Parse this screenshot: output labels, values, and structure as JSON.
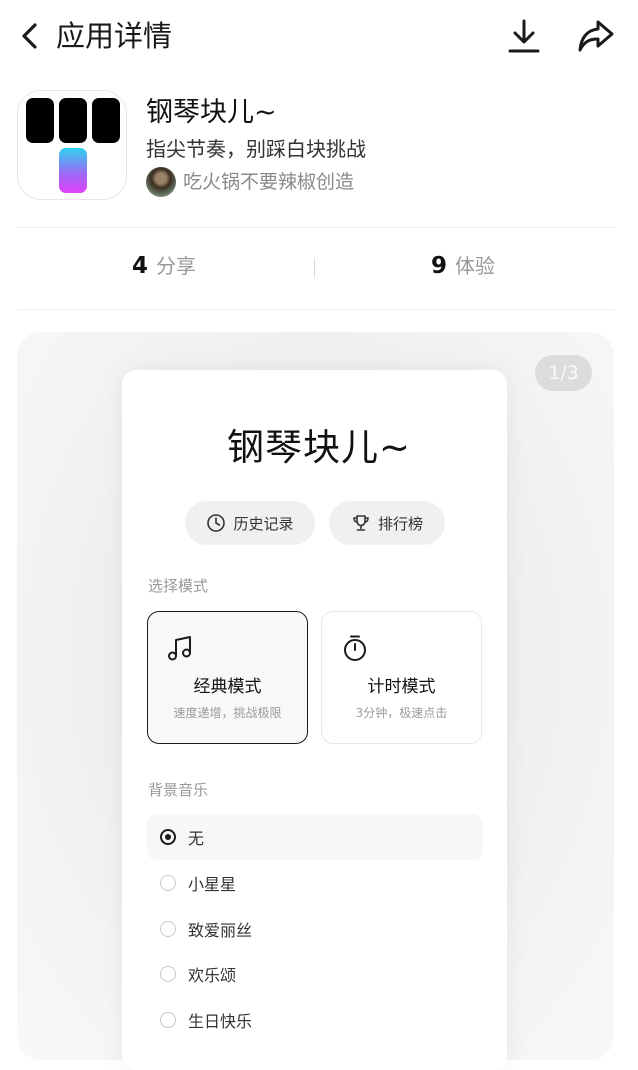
{
  "header": {
    "title": "应用详情",
    "back_icon": "chevron-left-icon",
    "download_icon": "download-icon",
    "share_icon": "share-arrow-icon"
  },
  "app": {
    "name": "钢琴块儿~",
    "tagline": "指尖节奏，别踩白块挑战",
    "author": "吃火锅不要辣椒创造"
  },
  "stats": {
    "shares": {
      "count": "4",
      "label": "分享"
    },
    "plays": {
      "count": "9",
      "label": "体验"
    }
  },
  "preview": {
    "page_indicator": "1/3",
    "game_title": "钢琴块儿~",
    "history_label": "历史记录",
    "rank_label": "排行榜",
    "mode_section_label": "选择模式",
    "modes": [
      {
        "title": "经典模式",
        "desc": "速度递增，挑战极限",
        "selected": true
      },
      {
        "title": "计时模式",
        "desc": "3分钟，极速点击",
        "selected": false
      }
    ],
    "music_section_label": "背景音乐",
    "music_options": [
      {
        "label": "无",
        "selected": true
      },
      {
        "label": "小星星",
        "selected": false
      },
      {
        "label": "致爱丽丝",
        "selected": false
      },
      {
        "label": "欢乐颂",
        "selected": false
      },
      {
        "label": "生日快乐",
        "selected": false
      }
    ]
  },
  "colors": {
    "accent_dark": "#1a1a1a",
    "gradient_top": "#2ed3f0",
    "gradient_bottom": "#e040fb"
  }
}
